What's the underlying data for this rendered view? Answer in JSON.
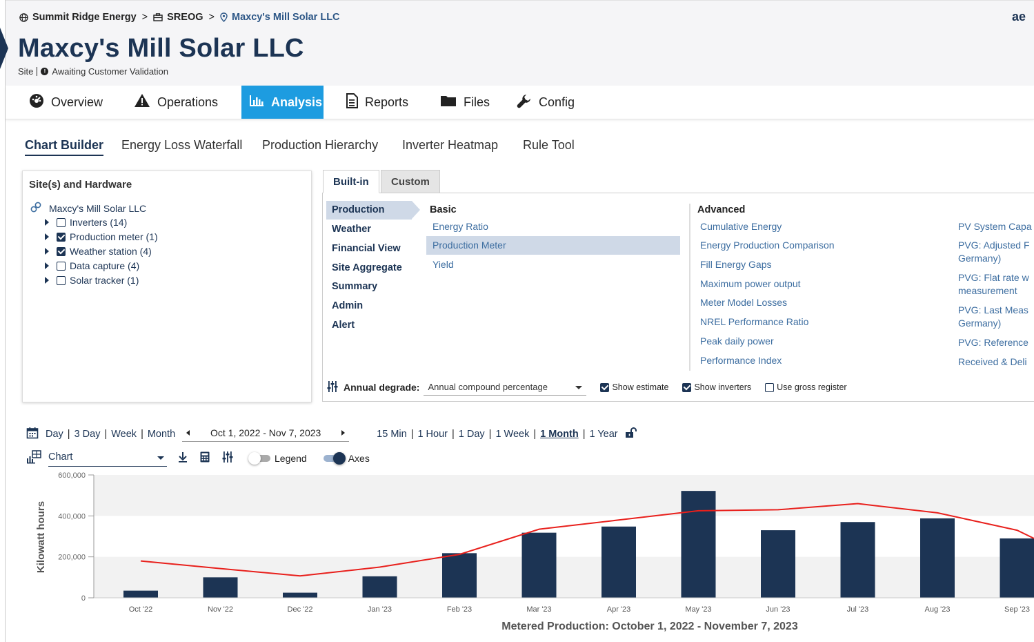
{
  "breadcrumb": {
    "org": "Summit Ridge Energy",
    "portfolio": "SREOG",
    "site": "Maxcy's Mill Solar LLC",
    "separator": ">"
  },
  "brand_text": "ae",
  "site": {
    "title": "Maxcy's Mill Solar LLC",
    "type_label": "Site",
    "status": "Awaiting Customer Validation"
  },
  "main_tabs": [
    {
      "label": "Overview",
      "icon": "speedometer-icon"
    },
    {
      "label": "Operations",
      "icon": "warning-icon"
    },
    {
      "label": "Analysis",
      "icon": "bar-chart-icon",
      "active": true
    },
    {
      "label": "Reports",
      "icon": "report-icon"
    },
    {
      "label": "Files",
      "icon": "folder-icon"
    },
    {
      "label": "Config",
      "icon": "wrench-icon"
    }
  ],
  "sub_tabs": [
    {
      "label": "Chart Builder",
      "active": true
    },
    {
      "label": "Energy Loss Waterfall"
    },
    {
      "label": "Production Hierarchy"
    },
    {
      "label": "Inverter Heatmap"
    },
    {
      "label": "Rule Tool"
    }
  ],
  "hardware_panel": {
    "title": "Site(s) and Hardware",
    "site_name": "Maxcy's Mill Solar LLC",
    "items": [
      {
        "label": "Inverters (14)",
        "checked": false
      },
      {
        "label": "Production meter (1)",
        "checked": true
      },
      {
        "label": "Weather station (4)",
        "checked": true
      },
      {
        "label": "Data capture (4)",
        "checked": false
      },
      {
        "label": "Solar tracker (1)",
        "checked": false
      }
    ]
  },
  "builder": {
    "tabs": [
      "Built-in",
      "Custom"
    ],
    "categories": [
      "Production",
      "Weather",
      "Financial View",
      "Site Aggregate",
      "Summary",
      "Admin",
      "Alert"
    ],
    "basic_title": "Basic",
    "basic_metrics": [
      "Energy Ratio",
      "Production Meter",
      "Yield"
    ],
    "advanced_title": "Advanced",
    "advanced_metrics": [
      "Cumulative Energy",
      "Energy Production Comparison",
      "Fill Energy Gaps",
      "Maximum power output",
      "Meter Model Losses",
      "NREL Performance Ratio",
      "Peak daily power",
      "Performance Index"
    ],
    "advanced_metrics_col3": [
      "PV System Capa",
      "PVG: Adjusted F",
      "Germany)",
      "PVG: Flat rate w",
      "measurement",
      "PVG: Last Meas",
      "Germany)",
      "PVG: Reference",
      "Received & Deli"
    ],
    "degrade_label": "Annual degrade:",
    "degrade_value": "Annual compound percentage",
    "options": [
      {
        "label": "Show estimate",
        "checked": true
      },
      {
        "label": "Show inverters",
        "checked": true
      },
      {
        "label": "Use gross register",
        "checked": false
      }
    ]
  },
  "toolbar": {
    "ranges": [
      "Day",
      "3 Day",
      "Week",
      "Month"
    ],
    "date_range": "Oct 1, 2022 - Nov 7, 2023",
    "granularity": [
      "15 Min",
      "1 Hour",
      "1 Day",
      "1 Week",
      "1 Month",
      "1 Year"
    ],
    "granularity_selected": "1 Month",
    "view_select": "Chart",
    "legend_label": "Legend",
    "legend_on": false,
    "axes_label": "Axes",
    "axes_on": true
  },
  "colors": {
    "navy": "#1c3454",
    "accent": "#1d9ce0",
    "link": "#3c6da0",
    "line": "#e8201c"
  },
  "chart_data": {
    "type": "bar",
    "title": "Metered Production: October 1, 2022 - November 7, 2023",
    "ylabel": "Kilowatt hours",
    "ylim": [
      0,
      600000
    ],
    "yticks": [
      "0",
      "200,000",
      "400,000",
      "600,000"
    ],
    "categories": [
      "Oct '22",
      "Nov '22",
      "Dec '22",
      "Jan '23",
      "Feb '23",
      "Mar '23",
      "Apr '23",
      "May '23",
      "Jun '23",
      "Jul '23",
      "Aug '23",
      "Sep '23"
    ],
    "series": [
      {
        "values": [
          35000,
          100000,
          25000,
          105000,
          218000,
          318000,
          348000,
          522000,
          330000,
          370000,
          388000,
          290000
        ]
      },
      {
        "values": [
          180000,
          143000,
          107000,
          150000,
          212000,
          335000,
          380000,
          425000,
          430000,
          460000,
          415000,
          330000
        ]
      }
    ],
    "grid": "horizontal bands"
  }
}
